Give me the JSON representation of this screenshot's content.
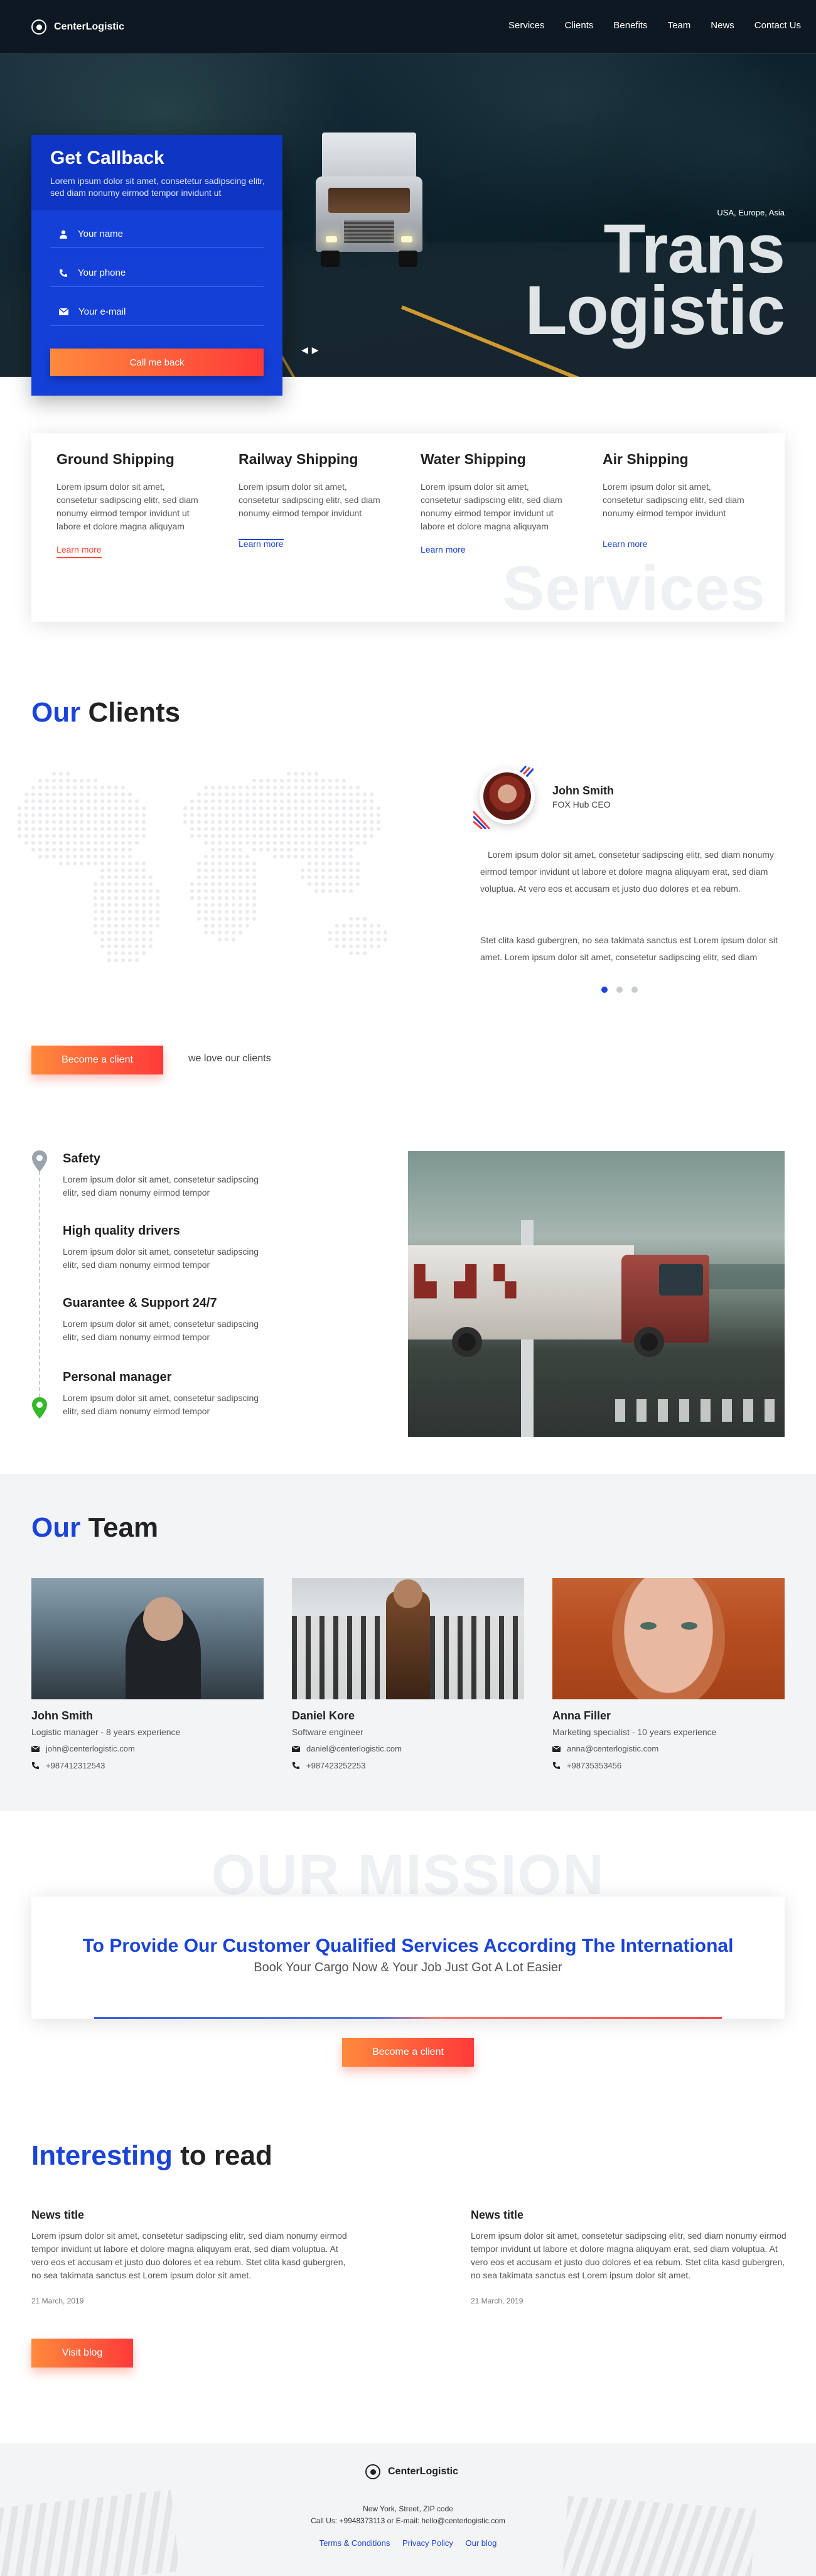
{
  "brand": {
    "name": "CenterLogistic"
  },
  "nav": {
    "items": [
      "Services",
      "Clients",
      "Benefits",
      "Team",
      "News",
      "Contact Us"
    ]
  },
  "hero": {
    "location": "USA, Europe, Asia",
    "title_line1": "Trans",
    "title_line2": "Logistic",
    "prev_label": "◀",
    "next_label": "▶"
  },
  "callback": {
    "title": "Get Callback",
    "subtitle": "Lorem ipsum dolor sit amet, consetetur sadipscing elitr, sed diam nonumy eirmod tempor invidunt ut",
    "name_placeholder": "Your name",
    "phone_placeholder": "Your phone",
    "email_placeholder": "Your e-mail",
    "button": "Call me back"
  },
  "services": {
    "watermark": "Services",
    "items": [
      {
        "title": "Ground Shipping",
        "text": "Lorem ipsum dolor sit amet, consetetur sadipscing elitr, sed diam nonumy eirmod tempor invidunt ut labore et dolore magna aliquyam",
        "link": "Learn more"
      },
      {
        "title": "Railway Shipping",
        "text": "Lorem ipsum dolor sit amet, consetetur sadipscing elitr, sed diam nonumy eirmod tempor invidunt",
        "link": "Learn more"
      },
      {
        "title": "Water Shipping",
        "text": "Lorem ipsum dolor sit amet, consetetur sadipscing elitr, sed diam nonumy eirmod tempor invidunt ut labore et dolore magna aliquyam",
        "link": "Learn more"
      },
      {
        "title": "Air Shipping",
        "text": "Lorem ipsum dolor sit amet, consetetur sadipscing elitr, sed diam nonumy eirmod tempor invidunt",
        "link": "Learn more"
      }
    ]
  },
  "clients": {
    "title_hl": "Our",
    "title_rest": " Clients",
    "client_name": "John Smith",
    "client_role": "FOX Hub CEO",
    "quote1": "Lorem ipsum dolor sit amet, consetetur sadipscing elitr, sed diam nonumy eirmod tempor invidunt ut labore et dolore magna aliquyam erat, sed diam voluptua. At vero eos et accusam et justo duo dolores et ea rebum.",
    "quote2": "Stet clita kasd gubergren, no sea takimata sanctus est Lorem ipsum dolor sit amet. Lorem ipsum dolor sit amet, consetetur sadipscing elitr, sed diam",
    "button": "Become a client",
    "tagline": "we love our clients"
  },
  "features": {
    "items": [
      {
        "title": "Safety",
        "text": "Lorem ipsum dolor sit amet, consetetur sadipscing elitr, sed diam nonumy eirmod tempor"
      },
      {
        "title": "High quality drivers",
        "text": "Lorem ipsum dolor sit amet, consetetur sadipscing elitr, sed diam nonumy eirmod tempor"
      },
      {
        "title": "Guarantee & Support 24/7",
        "text": "Lorem ipsum dolor sit amet, consetetur sadipscing elitr, sed diam nonumy eirmod tempor"
      },
      {
        "title": "Personal manager",
        "text": "Lorem ipsum dolor sit amet, consetetur sadipscing elitr, sed diam nonumy eirmod tempor"
      }
    ]
  },
  "team": {
    "title_hl": "Our",
    "title_rest": " Team",
    "members": [
      {
        "name": "John Smith",
        "role": "Logistic manager - 8 years experience",
        "email": "john@centerlogistic.com",
        "phone": "+987412312543"
      },
      {
        "name": "Daniel Kore",
        "role": "Software engineer",
        "email": "daniel@centerlogistic.com",
        "phone": "+987423252253"
      },
      {
        "name": "Anna Filler",
        "role": "Marketing specialist - 10 years experience",
        "email": "anna@centerlogistic.com",
        "phone": "+98735353456"
      }
    ]
  },
  "mission": {
    "watermark": "OUR MISSION",
    "heading": "To Provide Our Customer Qualified Services According The International",
    "subheading": "Book Your Cargo Now & Your Job Just Got A Lot Easier",
    "button": "Become a client"
  },
  "blog": {
    "title_hl": "Interesting",
    "title_rest": " to read",
    "posts": [
      {
        "title": "News title",
        "text": "Lorem ipsum dolor sit amet, consetetur sadipscing elitr, sed diam nonumy eirmod tempor invidunt ut labore et dolore magna aliquyam erat, sed diam voluptua. At vero eos et accusam et justo duo dolores et ea rebum. Stet clita kasd gubergren, no sea takimata sanctus est Lorem ipsum dolor sit amet.",
        "date": "21 March, 2019"
      },
      {
        "title": "News title",
        "text": "Lorem ipsum dolor sit amet, consetetur sadipscing elitr, sed diam nonumy eirmod tempor invidunt ut labore et dolore magna aliquyam erat, sed diam voluptua. At vero eos et accusam et justo duo dolores et ea rebum. Stet clita kasd gubergren, no sea takimata sanctus est Lorem ipsum dolor sit amet.",
        "date": "21 March, 2019"
      }
    ],
    "button": "Visit blog"
  },
  "footer": {
    "brand": "CenterLogistic",
    "address": "New York, Street, ZIP code",
    "contacts": "Call Us: +9948373113 or E-mail: hello@centerlogistic.com",
    "links": [
      "Terms & Conditions",
      "Privacy Policy",
      "Our blog"
    ]
  },
  "colors": {
    "accent": "#1a44d8",
    "gradient_start": "#ff8a3c",
    "gradient_end": "#ff3a3a",
    "nav_bg": "#0d1822"
  }
}
